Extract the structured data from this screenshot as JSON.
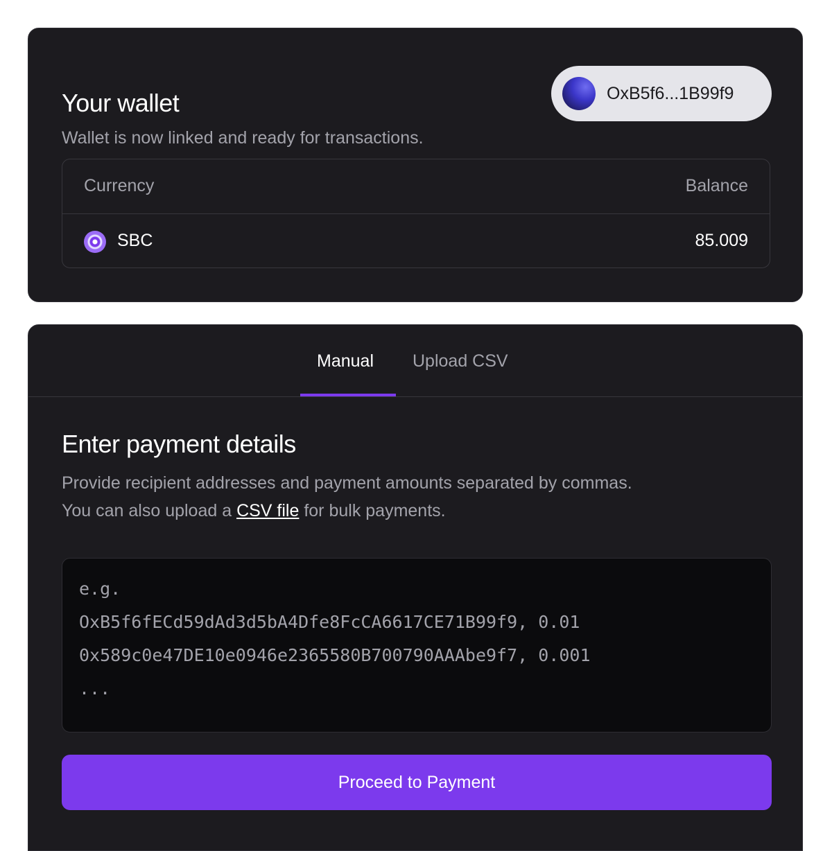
{
  "wallet": {
    "title": "Your wallet",
    "subtitle": "Wallet is now linked and ready for transactions.",
    "address": "OxB5f6...1B99f9",
    "avatar_icon": "wallet-avatar-icon"
  },
  "balances": {
    "headers": {
      "currency": "Currency",
      "balance": "Balance"
    },
    "rows": [
      {
        "icon": "sbc-coin-icon",
        "currency": "SBC",
        "balance": "85.009"
      }
    ]
  },
  "tabs": [
    {
      "label": "Manual",
      "active": true
    },
    {
      "label": "Upload CSV",
      "active": false
    }
  ],
  "payment": {
    "title": "Enter payment details",
    "description_line1": "Provide recipient addresses and payment amounts separated by commas.",
    "description_line2_prefix": "You can also upload a ",
    "csv_link": "CSV file",
    "description_line2_suffix": " for bulk payments.",
    "placeholder": "e.g.\nOxB5f6fECd59dAd3d5bA4Dfe8FcCA6617CE71B99f9, 0.01\n0x589c0e47DE10e0946e2365580B700790AAAbe9f7, 0.001\n...",
    "value": "",
    "button_label": "Proceed to Payment"
  },
  "colors": {
    "accent": "#7c3aed",
    "card_background": "#1c1b1f",
    "page_background": "#ffffff",
    "muted_text": "#a3a3ab"
  }
}
